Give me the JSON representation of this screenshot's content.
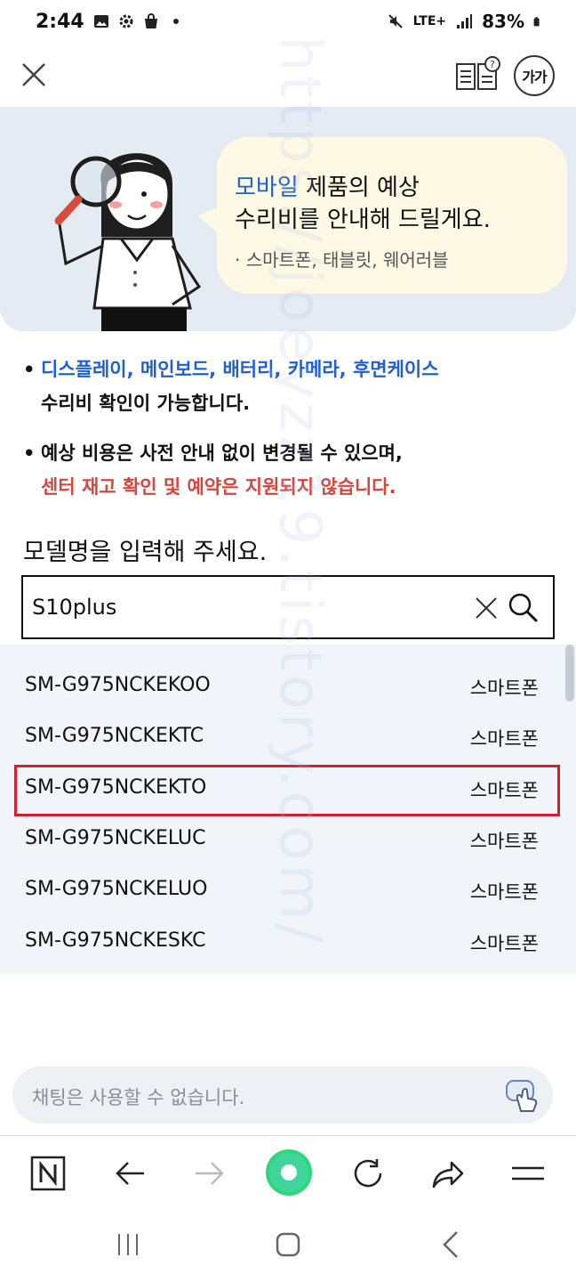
{
  "status_bar": {
    "time": "2:44",
    "network": "LTE+",
    "battery": "83%",
    "icons": [
      "gallery-icon",
      "settings-icon",
      "bag-icon",
      "mute-icon",
      "signal-icon",
      "battery-icon"
    ]
  },
  "header": {
    "close_icon": "close-icon",
    "guide_icon": "guide-book-icon",
    "font_size_label": "가가"
  },
  "hero": {
    "highlight": "모바일",
    "line1_rest": " 제품의 예상",
    "line2": "수리비를 안내해 드릴게요.",
    "line3": "· 스마트폰, 태블릿, 웨어러블"
  },
  "notices": [
    {
      "line1": "디스플레이, 메인보드, 배터리, 카메라, 후면케이스",
      "line2": "수리비 확인이 가능합니다."
    },
    {
      "line1": "예상 비용은 사전 안내 없이 변경될 수 있으며,",
      "line2": "센터 재고 확인 및 예약은 지원되지 않습니다."
    }
  ],
  "prompt": "모델명을 입력해 주세요.",
  "search": {
    "value": "S10plus"
  },
  "results": [
    {
      "model": "SM-G975NCKEKOO",
      "category": "스마트폰"
    },
    {
      "model": "SM-G975NCKEKTC",
      "category": "스마트폰"
    },
    {
      "model": "SM-G975NCKEKTO",
      "category": "스마트폰",
      "selected": true
    },
    {
      "model": "SM-G975NCKELUC",
      "category": "스마트폰"
    },
    {
      "model": "SM-G975NCKELUO",
      "category": "스마트폰"
    },
    {
      "model": "SM-G975NCKESKC",
      "category": "스마트폰"
    }
  ],
  "chat": {
    "placeholder": "채팅은 사용할 수 없습니다."
  },
  "browser_bar": [
    "naver-icon",
    "back-arrow-icon",
    "forward-arrow-icon",
    "home-orb-icon",
    "refresh-icon",
    "share-icon",
    "menu-icon"
  ],
  "nav_bar": [
    "recents-icon",
    "home-icon",
    "back-icon"
  ],
  "watermark": "https://joeyzz19.tistory.com/",
  "colors": {
    "accent_blue": "#1f5fd6",
    "warning_red": "#d9443b",
    "highlight_red": "#d61f2c",
    "hero_bg": "#e4ebf3",
    "bubble_bg": "#fdf9e4"
  }
}
